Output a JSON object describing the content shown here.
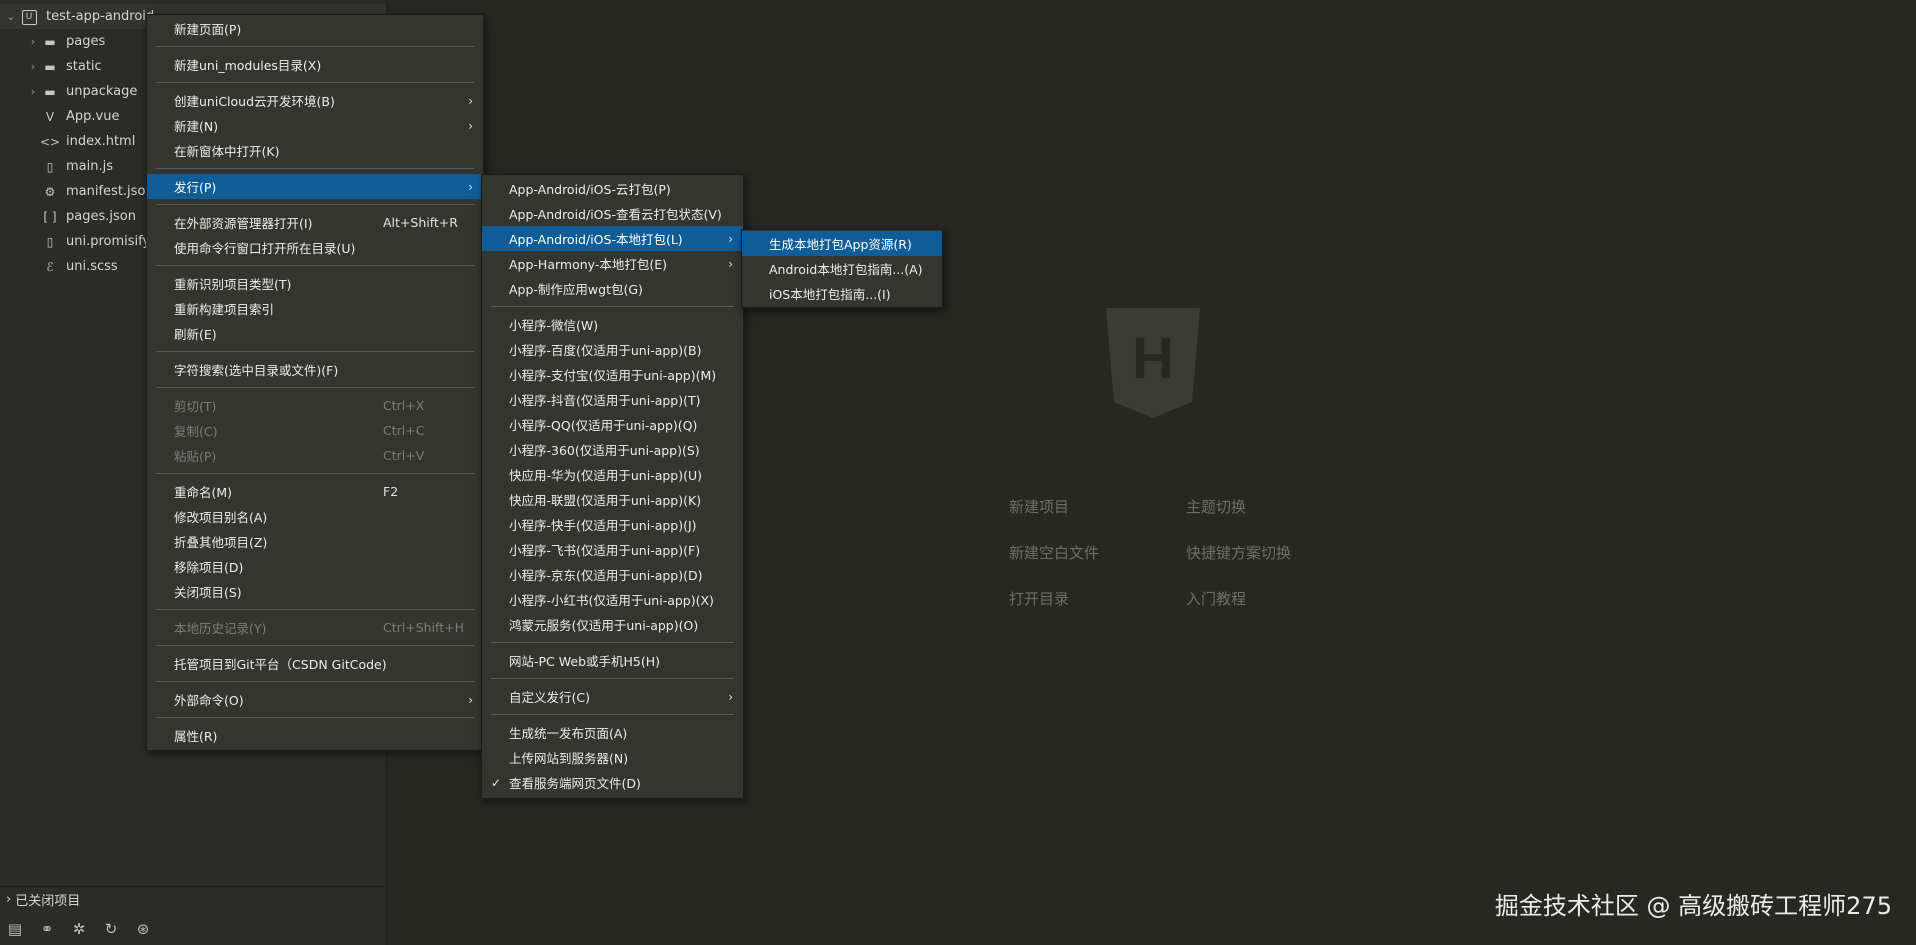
{
  "sidebar": {
    "root": {
      "name": "test-app-android",
      "badge": "U"
    },
    "items": [
      {
        "icon": "folder-icon",
        "glyph": "▬",
        "label": "pages",
        "folder": true
      },
      {
        "icon": "folder-icon",
        "glyph": "▬",
        "label": "static",
        "folder": true
      },
      {
        "icon": "folder-icon",
        "glyph": "▬",
        "label": "unpackage",
        "folder": true
      },
      {
        "icon": "vue-file-icon",
        "glyph": "V",
        "label": "App.vue",
        "folder": false
      },
      {
        "icon": "html-file-icon",
        "glyph": "<>",
        "label": "index.html",
        "folder": false
      },
      {
        "icon": "js-file-icon",
        "glyph": "▯",
        "label": "main.js",
        "folder": false
      },
      {
        "icon": "json-settings-icon",
        "glyph": "⚙",
        "label": "manifest.json",
        "folder": false
      },
      {
        "icon": "json-file-icon",
        "glyph": "[ ]",
        "label": "pages.json",
        "folder": false
      },
      {
        "icon": "js-file-icon",
        "glyph": "▯",
        "label": "uni.promisify.a",
        "folder": false
      },
      {
        "icon": "scss-file-icon",
        "glyph": "ℰ",
        "label": "uni.scss",
        "folder": false
      }
    ],
    "closed_projects": "已关闭项目",
    "bottom_icons": [
      {
        "name": "project-manager-icon",
        "glyph": "▤"
      },
      {
        "name": "binoculars-icon",
        "glyph": "⚭"
      },
      {
        "name": "debug-bug-icon",
        "glyph": "✲"
      },
      {
        "name": "git-sync-icon",
        "glyph": "↻"
      },
      {
        "name": "plugin-icon",
        "glyph": "⊛"
      }
    ]
  },
  "welcome": {
    "links": [
      "新建项目",
      "主题切换",
      "新建空白文件",
      "快捷键方案切换",
      "打开目录",
      "入门教程"
    ],
    "logo_letter": "H"
  },
  "watermark": "掘金技术社区 @ 高级搬砖工程师275",
  "context_menu": [
    {
      "label": "新建页面(P)"
    },
    {
      "sep": true
    },
    {
      "label": "新建uni_modules目录(X)"
    },
    {
      "sep": true
    },
    {
      "label": "创建uniCloud云开发环境(B)",
      "arrow": true
    },
    {
      "label": "新建(N)",
      "arrow": true
    },
    {
      "label": "在新窗体中打开(K)"
    },
    {
      "sep": true
    },
    {
      "label": "发行(P)",
      "arrow": true,
      "hl": true
    },
    {
      "sep": true
    },
    {
      "label": "在外部资源管理器打开(I)",
      "shortcut": "Alt+Shift+R"
    },
    {
      "label": "使用命令行窗口打开所在目录(U)"
    },
    {
      "sep": true
    },
    {
      "label": "重新识别项目类型(T)"
    },
    {
      "label": "重新构建项目索引"
    },
    {
      "label": "刷新(E)"
    },
    {
      "sep": true
    },
    {
      "label": "字符搜索(选中目录或文件)(F)"
    },
    {
      "sep": true
    },
    {
      "label": "剪切(T)",
      "shortcut": "Ctrl+X",
      "disabled": true
    },
    {
      "label": "复制(C)",
      "shortcut": "Ctrl+C",
      "disabled": true
    },
    {
      "label": "粘贴(P)",
      "shortcut": "Ctrl+V",
      "disabled": true
    },
    {
      "sep": true
    },
    {
      "label": "重命名(M)",
      "shortcut": "F2"
    },
    {
      "label": "修改项目别名(A)"
    },
    {
      "label": "折叠其他项目(Z)"
    },
    {
      "label": "移除项目(D)"
    },
    {
      "label": "关闭项目(S)"
    },
    {
      "sep": true
    },
    {
      "label": "本地历史记录(Y)",
      "shortcut": "Ctrl+Shift+H",
      "disabled": true
    },
    {
      "sep": true
    },
    {
      "label": "托管项目到Git平台（CSDN GitCode)"
    },
    {
      "sep": true
    },
    {
      "label": "外部命令(O)",
      "arrow": true
    },
    {
      "sep": true
    },
    {
      "label": "属性(R)"
    }
  ],
  "publish_menu": [
    {
      "label": "App-Android/iOS-云打包(P)"
    },
    {
      "label": "App-Android/iOS-查看云打包状态(V)"
    },
    {
      "label": "App-Android/iOS-本地打包(L)",
      "arrow": true,
      "hl": true
    },
    {
      "label": "App-Harmony-本地打包(E)",
      "arrow": true
    },
    {
      "label": "App-制作应用wgt包(G)"
    },
    {
      "sep": true
    },
    {
      "label": "小程序-微信(W)"
    },
    {
      "label": "小程序-百度(仅适用于uni-app)(B)"
    },
    {
      "label": "小程序-支付宝(仅适用于uni-app)(M)"
    },
    {
      "label": "小程序-抖音(仅适用于uni-app)(T)"
    },
    {
      "label": "小程序-QQ(仅适用于uni-app)(Q)"
    },
    {
      "label": "小程序-360(仅适用于uni-app)(S)"
    },
    {
      "label": "快应用-华为(仅适用于uni-app)(U)"
    },
    {
      "label": "快应用-联盟(仅适用于uni-app)(K)"
    },
    {
      "label": "小程序-快手(仅适用于uni-app)(J)"
    },
    {
      "label": "小程序-飞书(仅适用于uni-app)(F)"
    },
    {
      "label": "小程序-京东(仅适用于uni-app)(D)"
    },
    {
      "label": "小程序-小红书(仅适用于uni-app)(X)"
    },
    {
      "label": "鸿蒙元服务(仅适用于uni-app)(O)"
    },
    {
      "sep": true
    },
    {
      "label": "网站-PC Web或手机H5(H)"
    },
    {
      "sep": true
    },
    {
      "label": "自定义发行(C)",
      "arrow": true
    },
    {
      "sep": true
    },
    {
      "label": "生成统一发布页面(A)"
    },
    {
      "label": "上传网站到服务器(N)"
    },
    {
      "label": "查看服务端网页文件(D)",
      "checked": true
    }
  ],
  "local_pack_menu": [
    {
      "label": "生成本地打包App资源(R)",
      "hl": true
    },
    {
      "label": "Android本地打包指南...(A)"
    },
    {
      "label": "iOS本地打包指南...(I)"
    }
  ],
  "colors": {
    "highlight": "#0e5d99",
    "menu_bg": "#35352f",
    "editor_bg": "#272822"
  }
}
